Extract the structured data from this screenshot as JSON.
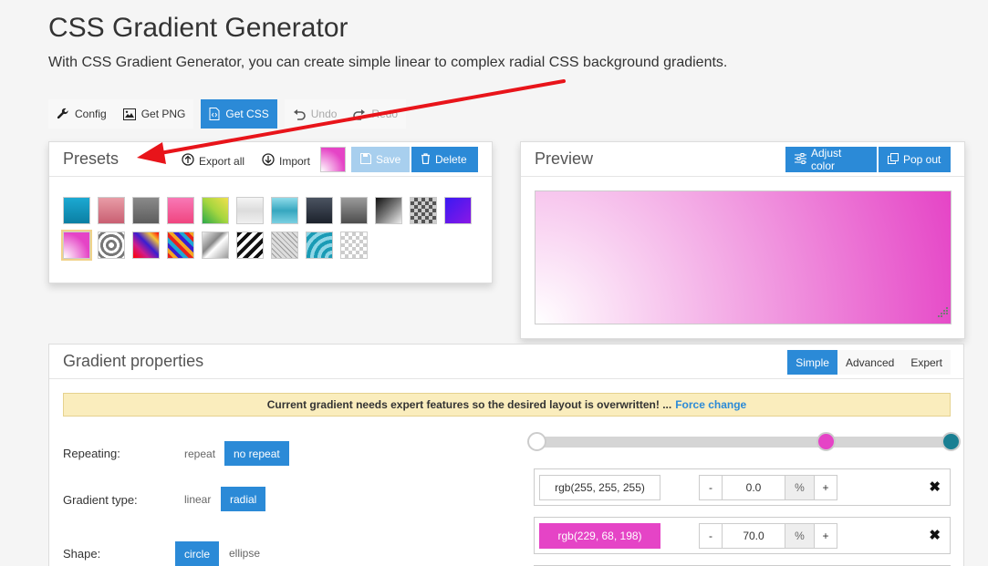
{
  "page": {
    "title": "CSS Gradient Generator",
    "subtitle": "With CSS Gradient Generator, you can create simple linear to complex radial CSS background gradients."
  },
  "toolbar": {
    "config": "Config",
    "get_png": "Get PNG",
    "get_css": "Get CSS",
    "undo": "Undo",
    "redo": "Redo"
  },
  "presets": {
    "title": "Presets",
    "export_all": "Export all",
    "import": "Import",
    "save": "Save",
    "delete": "Delete",
    "swatch_count": 22
  },
  "preview": {
    "title": "Preview",
    "adjust_color": "Adjust color",
    "pop_out": "Pop out"
  },
  "gradient_properties": {
    "title": "Gradient properties",
    "modes": [
      "Simple",
      "Advanced",
      "Expert"
    ],
    "active_mode": "Simple",
    "notice": "Current gradient needs expert features so the desired layout is overwritten! ...",
    "notice_link": "Force change",
    "repeating": {
      "label": "Repeating:",
      "options": [
        "repeat",
        "no repeat"
      ],
      "selected": "no repeat"
    },
    "gradient_type": {
      "label": "Gradient type:",
      "options": [
        "linear",
        "radial"
      ],
      "selected": "radial"
    },
    "shape": {
      "label": "Shape:",
      "options": [
        "circle",
        "ellipse"
      ],
      "selected": "circle"
    }
  },
  "stops": [
    {
      "color": "rgb(255, 255, 255)",
      "position": "0.0",
      "unit": "%",
      "hex": "#ffffff",
      "text_color": "#333333"
    },
    {
      "color": "rgb(229, 68, 198)",
      "position": "70.0",
      "unit": "%",
      "hex": "#e544c6",
      "text_color": "#ffffff"
    }
  ],
  "slider_handles": [
    {
      "position_pct": 0,
      "color": "#ffffff"
    },
    {
      "position_pct": 70,
      "color": "#e544c6"
    },
    {
      "position_pct": 100,
      "color": "#1a7f92"
    }
  ],
  "colors": {
    "accent": "#2b8ad7",
    "arrow": "#e8141a"
  }
}
